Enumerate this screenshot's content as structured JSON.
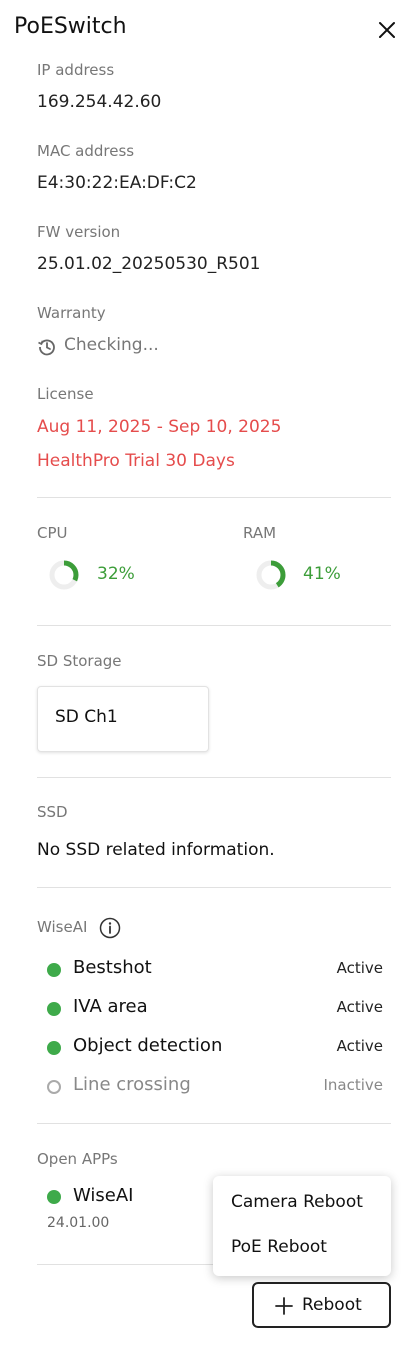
{
  "header": {
    "title": "PoESwitch"
  },
  "device": {
    "ip_label": "IP address",
    "ip_value": "169.254.42.60",
    "mac_label": "MAC address",
    "mac_value": "E4:30:22:EA:DF:C2",
    "fw_label": "FW version",
    "fw_value": "25.01.02_20250530_R501",
    "warranty_label": "Warranty",
    "warranty_value": "Checking...",
    "license_label": "License",
    "license_dates": "Aug 11, 2025 - Sep 10, 2025",
    "license_plan": "HealthPro Trial 30 Days"
  },
  "usage": {
    "cpu_label": "CPU",
    "cpu_value": "32%",
    "cpu_fraction": 0.32,
    "ram_label": "RAM",
    "ram_value": "41%",
    "ram_fraction": 0.41,
    "color": "#3c9d39"
  },
  "sd": {
    "label": "SD Storage",
    "card": "SD Ch1"
  },
  "ssd": {
    "label": "SSD",
    "message": "No SSD related information."
  },
  "wiseai": {
    "label": "WiseAI",
    "features": [
      {
        "name": "Bestshot",
        "status": "Active"
      },
      {
        "name": "IVA area",
        "status": "Active"
      },
      {
        "name": "Object detection",
        "status": "Active"
      },
      {
        "name": "Line crossing",
        "status": "Inactive"
      }
    ]
  },
  "apps": {
    "label": "Open APPs",
    "name": "WiseAI",
    "version": "24.01.00"
  },
  "menu": {
    "camera_reboot": "Camera Reboot",
    "poe_reboot": "PoE Reboot"
  },
  "reboot_button": {
    "label": "Reboot"
  },
  "colors": {
    "active": "#3eaa4a",
    "license": "#e54c4c",
    "divider": "#e1e1e1"
  },
  "icons": [
    "close-icon",
    "history-icon",
    "info-icon",
    "plus-icon"
  ]
}
